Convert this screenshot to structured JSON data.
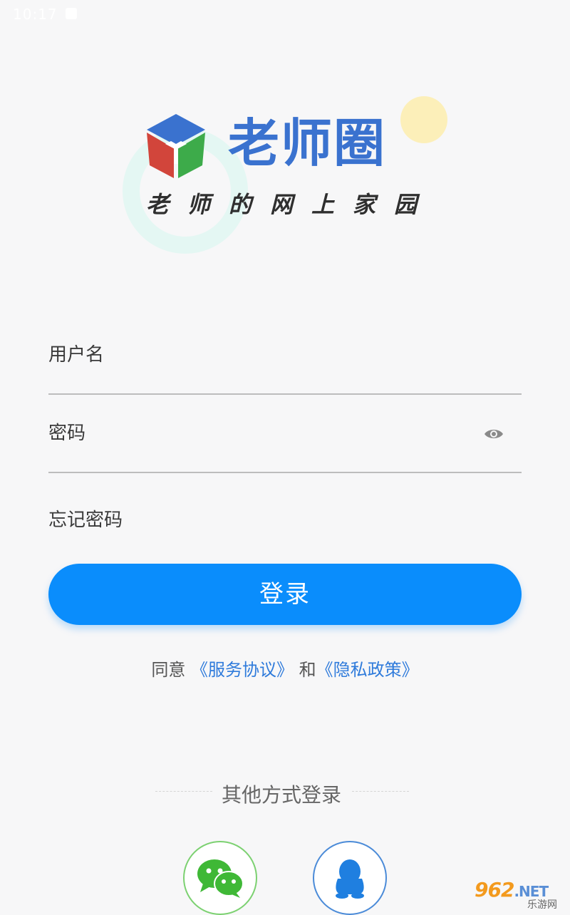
{
  "status_bar": {
    "time": "10:17"
  },
  "logo": {
    "brand_name": "老师圈",
    "slogan": "老师的网上家园",
    "cube_colors": {
      "top": "#3a72cf",
      "left": "#d2453b",
      "right": "#3dab4a",
      "center_mark": "#ffffff"
    }
  },
  "form": {
    "username_placeholder": "用户名",
    "password_placeholder": "密码",
    "password_toggle_icon": "eye-icon",
    "forgot_password": "忘记密码",
    "login_button": "登录"
  },
  "agreement": {
    "prefix": "同意",
    "service_link": "《服务协议》",
    "conjunction": "和",
    "privacy_link": "《隐私政策》"
  },
  "other_login": {
    "title": "其他方式登录",
    "wechat_icon": "wechat-icon",
    "qq_icon": "qq-icon"
  },
  "watermark": {
    "main": "962",
    "suffix": ".NET",
    "sub": "乐游网"
  },
  "colors": {
    "primary_button": "#0a8dfc",
    "link": "#2f7bdb",
    "brand": "#3a72cf",
    "wechat": "#3fb836",
    "qq": "#1f7fe0"
  }
}
